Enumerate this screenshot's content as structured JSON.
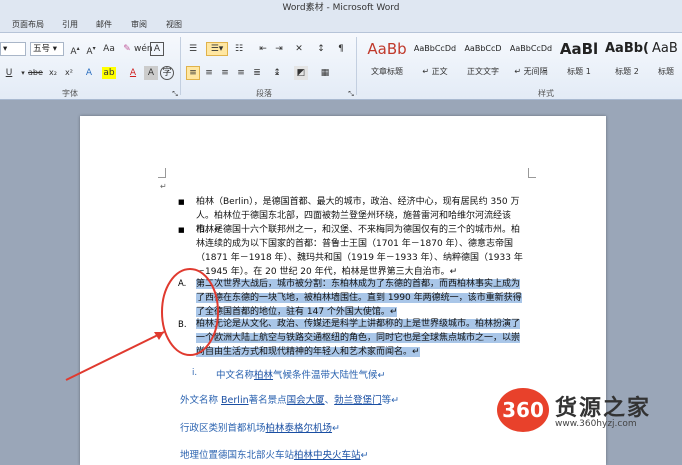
{
  "window": {
    "title": "Word素材 - Microsoft Word"
  },
  "tabs": [
    "页面布局",
    "引用",
    "邮件",
    "审阅",
    "视图"
  ],
  "ribbon": {
    "font_size": "五号",
    "group_font": "字体",
    "group_paragraph": "段落",
    "group_styles": "样式",
    "styles": [
      {
        "sample": "AaBb",
        "name": "文章标题"
      },
      {
        "sample": "AaBbCcDd",
        "name": "↵ 正文"
      },
      {
        "sample": "AaBbCcD",
        "name": "正文文字"
      },
      {
        "sample": "AaBbCcDd",
        "name": "↵ 无间隔"
      },
      {
        "sample": "AaBl",
        "name": "标题 1"
      },
      {
        "sample": "AaBb(",
        "name": "标题 2"
      },
      {
        "sample": "AaB",
        "name": "标题"
      }
    ]
  },
  "document": {
    "bullets": [
      "柏林（Berlin），是德国首都、最大的城市，政治、经济中心，现有居民约 350 万人。柏林位于德国东北部，四面被勃兰登堡州环绕，施普雷河和哈维尔河流经该市。↵",
      "柏林是德国十六个联邦州之一，和汉堡、不来梅同为德国仅有的三个的城市州。柏林连续的成为以下国家的首都：普鲁士王国（1701 年－1870 年）、德意志帝国（1871 年－1918 年）、魏玛共和国（1919 年－1933 年）、纳粹德国（1933 年－1945 年）。在 20 世纪 20 年代，柏林是世界第三大自治市。↵"
    ],
    "numbered": [
      {
        "mark": "A.",
        "text": "第二次世界大战后，城市被分割：东柏林成为了东德的首都，而西柏林事实上成为了西德在东德的一块飞地，被柏林墙围住。直到 1990 年两德统一，该市重新获得了全德国首都的地位，驻有 147 个外国大使馆。↵"
      },
      {
        "mark": "B.",
        "text": "柏林无论是从文化、政治、传媒还是科学上讲都称的上是世界级城市。柏林扮演了一个欧洲大陆上航空与铁路交通枢纽的角色，同时它也是全球焦点城市之一，以崇尚自由生活方式和现代精神的年轻人和艺术家而闻名。↵"
      }
    ],
    "roman_item": {
      "mark": "i.",
      "pre": "中文名称",
      "link": "柏林",
      "post": "气候条件温带大陆性气候↵"
    },
    "line1": {
      "pre": "外文名称 ",
      "link1": "Berlin",
      "mid": "著名景点",
      "link2": "国会大厦",
      "sep": "、",
      "link3": "勃兰登堡门",
      "post": "等↵"
    },
    "line2": {
      "pre": "行政区类别首都机场",
      "link": "柏林泰格尔机场",
      "post": "↵"
    },
    "line3": {
      "pre": "地理位置德国东北部火车站",
      "link": "柏林中央火车站",
      "post": "↵"
    },
    "cursor_mark": "↵"
  },
  "watermark": {
    "logo": "360",
    "title": "货源之家",
    "url": "www.360hyzj.com"
  },
  "colors": {
    "highlight": "#a9c6e8",
    "annotation": "#e03a2f",
    "link": "#1a4fa3"
  }
}
